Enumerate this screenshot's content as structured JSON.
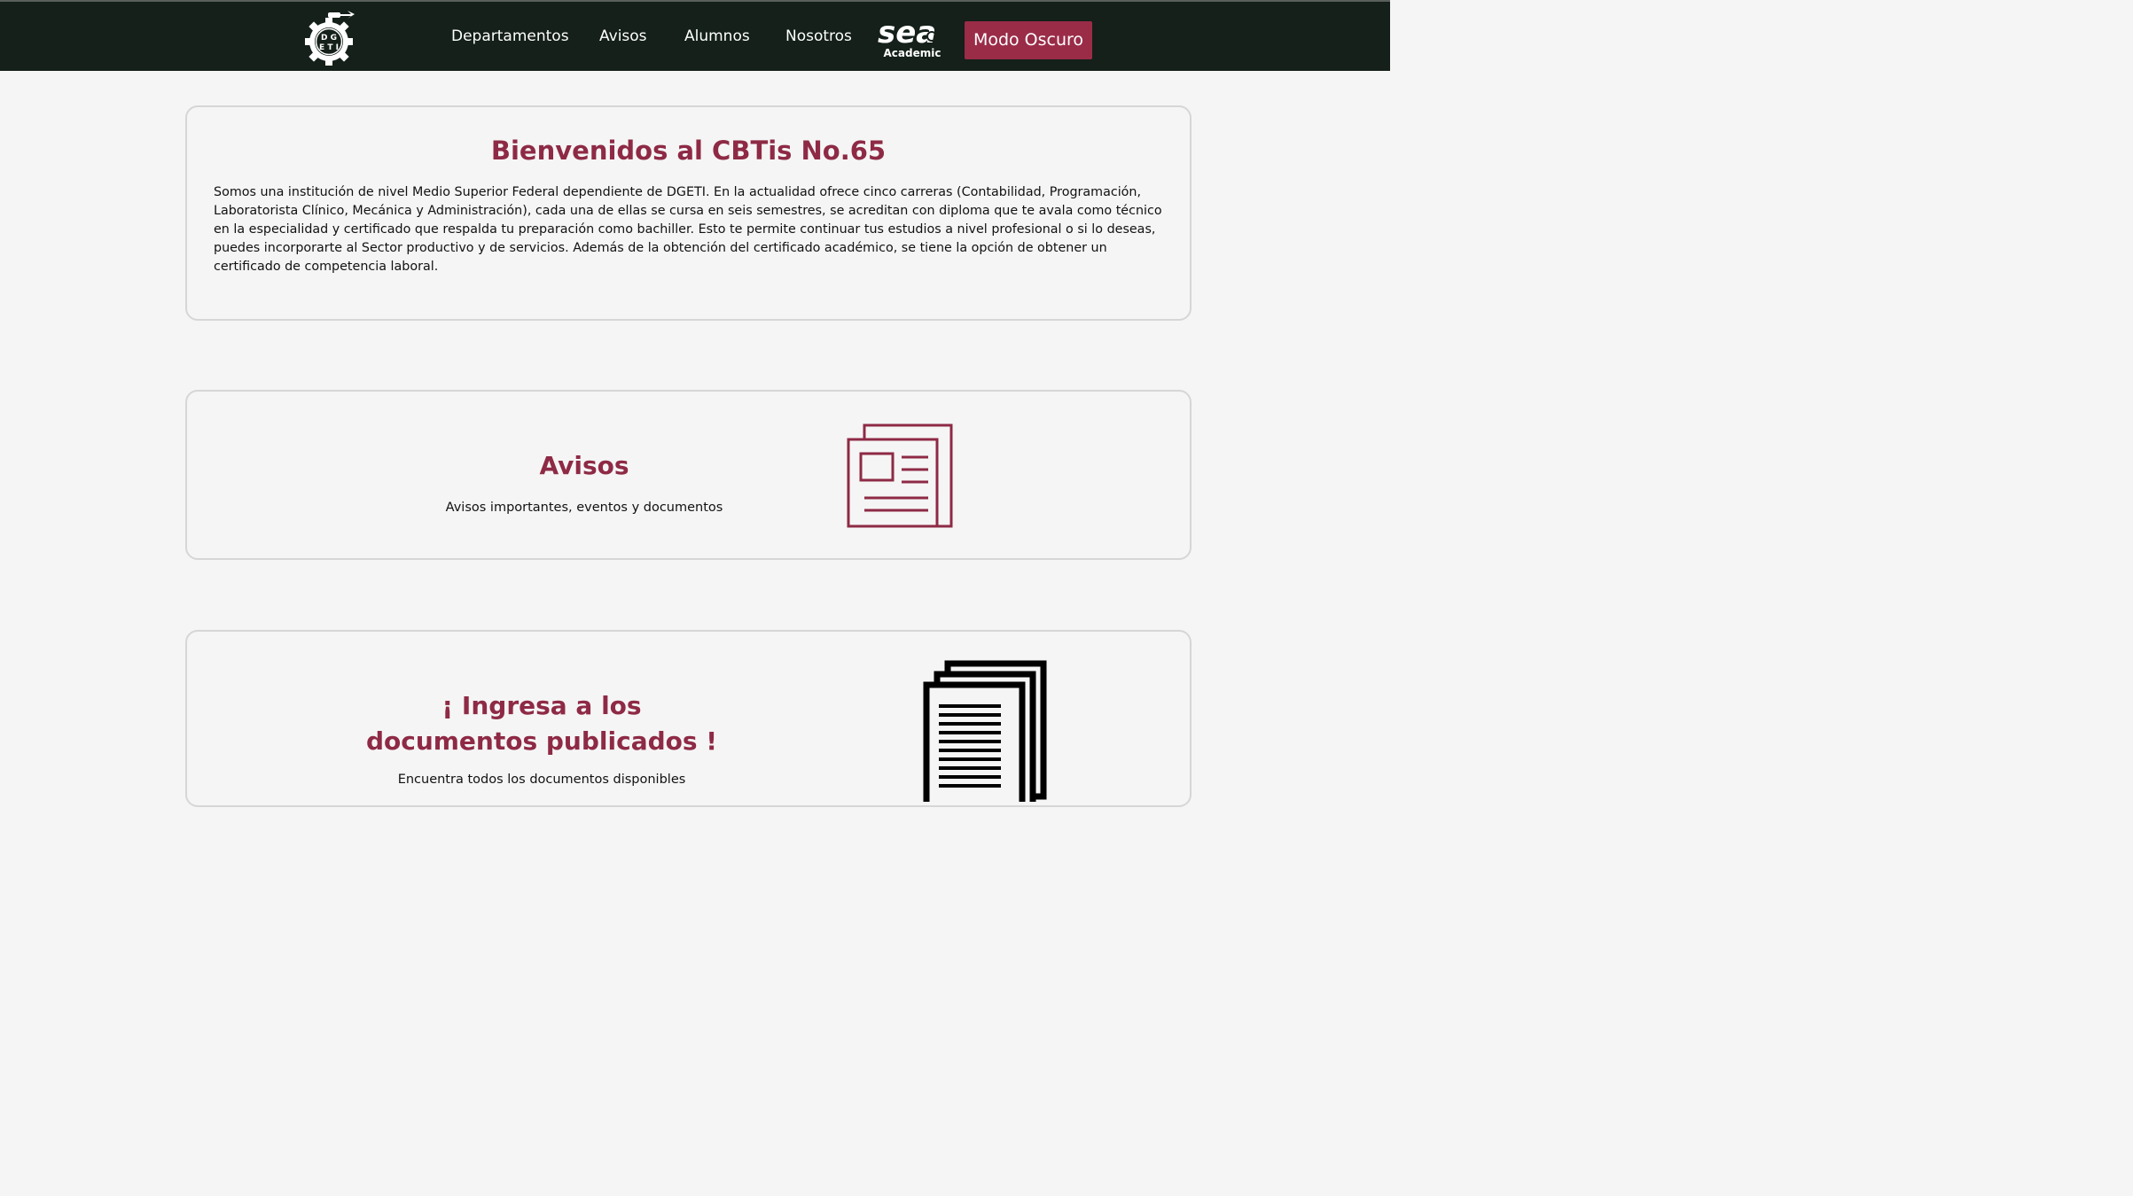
{
  "header": {
    "logo_icon": "dgeti-gear-logo",
    "logo_text": "DGETI",
    "nav": [
      {
        "label": "Departamentos"
      },
      {
        "label": "Avisos"
      },
      {
        "label": "Alumnos"
      },
      {
        "label": "Nosotros"
      }
    ],
    "sea_logo_text": "sea",
    "sea_logo_sub": "Academic",
    "mode_button": "Modo Oscuro"
  },
  "welcome": {
    "title": "Bienvenidos al CBTis No.65",
    "body": "Somos una institución de nivel Medio Superior Federal dependiente de DGETI. En la actualidad ofrece cinco carreras (Contabilidad, Programación, Laboratorista Clínico, Mecánica y Administración), cada una de ellas se cursa en seis semestres, se acreditan con diploma que te avala como técnico en la especialidad y certificado que respalda tu preparación como bachiller. Esto te permite continuar tus estudios a nivel profesional o si lo deseas, puedes incorporarte al Sector productivo y de servicios. Además de la obtención del certificado académico, se tiene la opción de obtener un certificado de competencia laboral."
  },
  "avisos": {
    "title": "Avisos",
    "subtitle": "Avisos importantes, eventos y documentos",
    "icon": "newspaper-icon"
  },
  "documentos": {
    "title": "¡ Ingresa a los documentos publicados !",
    "subtitle": "Encuentra todos los documentos disponibles",
    "icon": "documents-stack-icon"
  },
  "colors": {
    "header_bg": "#142019",
    "accent": "#9a2c48",
    "heading": "#8e2a45",
    "page_bg": "#f5f5f5"
  }
}
